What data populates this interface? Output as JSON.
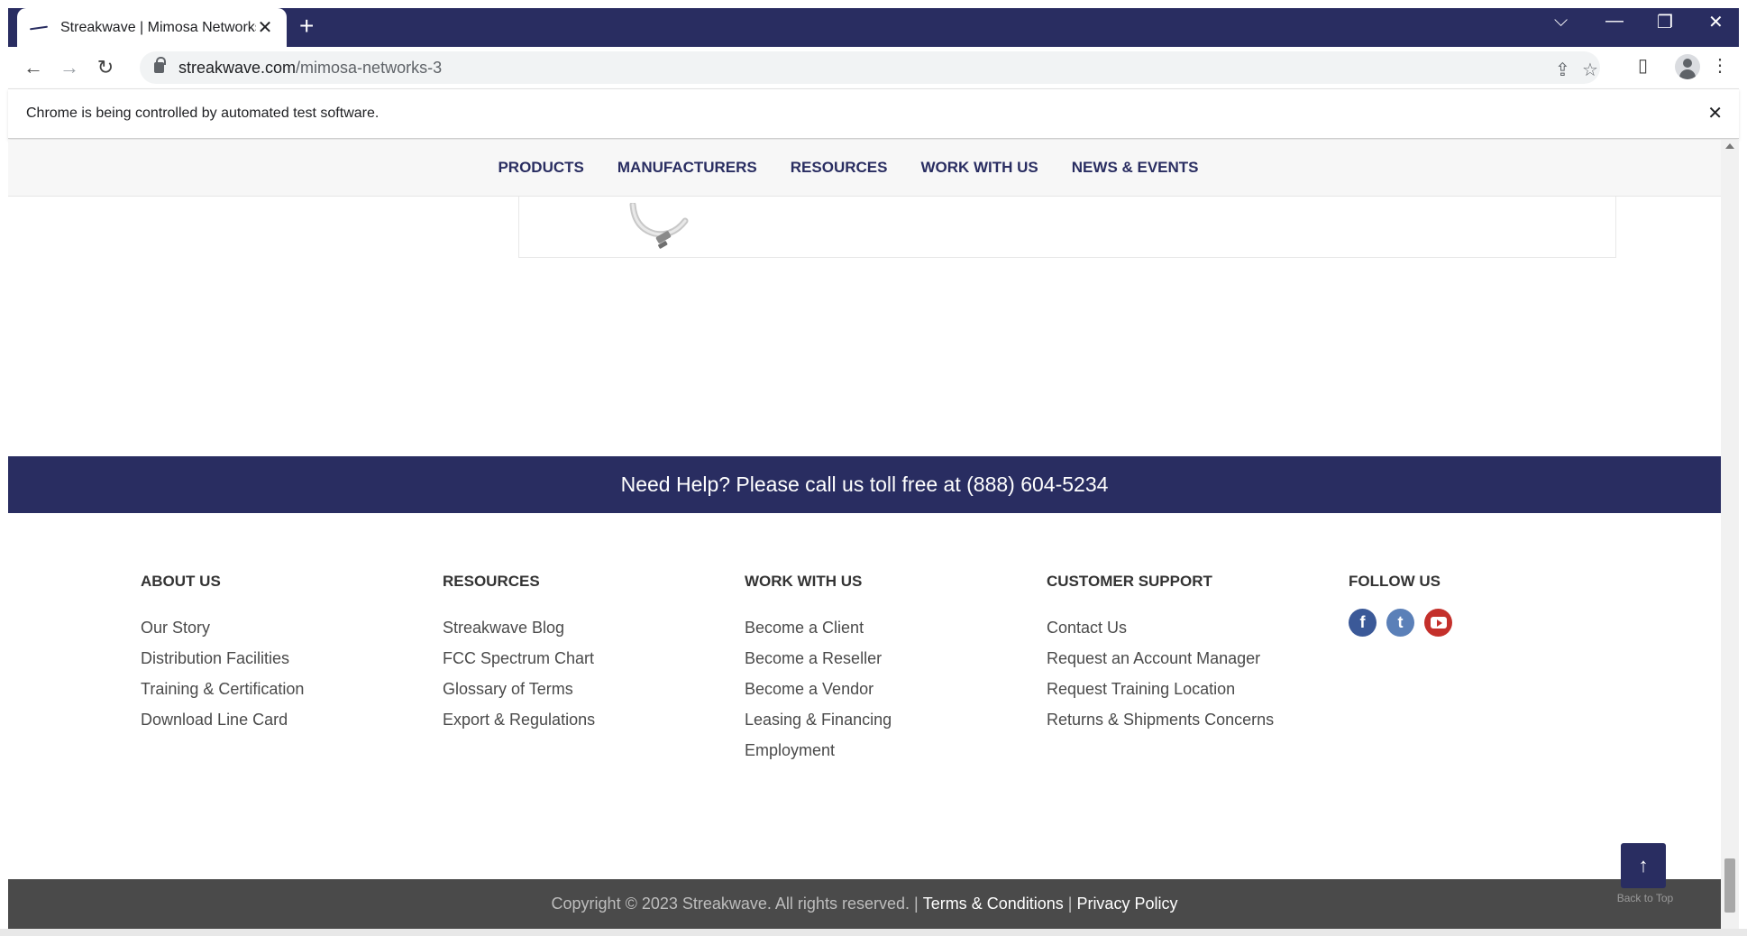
{
  "browser": {
    "tab_title": "Streakwave | Mimosa Networks",
    "tab_close": "✕",
    "new_tab": "+",
    "url_host": "streakwave.com",
    "url_path": "/mimosa-networks-3",
    "infobar_message": "Chrome is being controlled by automated test software.",
    "infobar_close": "✕",
    "controls": {
      "tabsearch": "⌵",
      "minimize": "—",
      "restore": "❐",
      "close": "✕"
    },
    "nav": {
      "back": "←",
      "forward": "→",
      "reload": "↻"
    },
    "icons": {
      "share": "⇪",
      "star": "☆",
      "sidepanel": "▯",
      "menu": "⋮"
    }
  },
  "mainnav": {
    "items": [
      "PRODUCTS",
      "MANUFACTURERS",
      "RESOURCES",
      "WORK WITH US",
      "NEWS & EVENTS"
    ]
  },
  "help": {
    "text": "Need Help? Please call us toll free at (888) 604-5234"
  },
  "footer": {
    "about": {
      "heading": "ABOUT US",
      "links": [
        "Our Story",
        "Distribution Facilities",
        "Training & Certification",
        "Download Line Card"
      ]
    },
    "resources": {
      "heading": "RESOURCES",
      "links": [
        "Streakwave Blog",
        "FCC Spectrum Chart",
        "Glossary of Terms",
        "Export & Regulations"
      ]
    },
    "work": {
      "heading": "WORK WITH US",
      "links": [
        "Become a Client",
        "Become a Reseller",
        "Become a Vendor",
        "Leasing & Financing",
        "Employment"
      ]
    },
    "support": {
      "heading": "CUSTOMER SUPPORT",
      "links": [
        "Contact Us",
        "Request an Account Manager",
        "Request Training Location",
        "Returns & Shipments Concerns"
      ]
    },
    "follow": {
      "heading": "FOLLOW US",
      "facebook_glyph": "f",
      "twitter_glyph": "t"
    }
  },
  "copyright": {
    "text": "Copyright © 2023 Streakwave. All rights reserved. |",
    "terms": "Terms & Conditions",
    "sep": "|",
    "privacy": "Privacy Policy"
  },
  "back_to_top": {
    "arrow": "↑",
    "label": "Back to Top"
  },
  "colors": {
    "brand_navy": "#292d61",
    "footer_dark": "#4a4a4a",
    "facebook": "#3b5998",
    "twitter": "#5b80b8",
    "youtube": "#c4302b"
  }
}
